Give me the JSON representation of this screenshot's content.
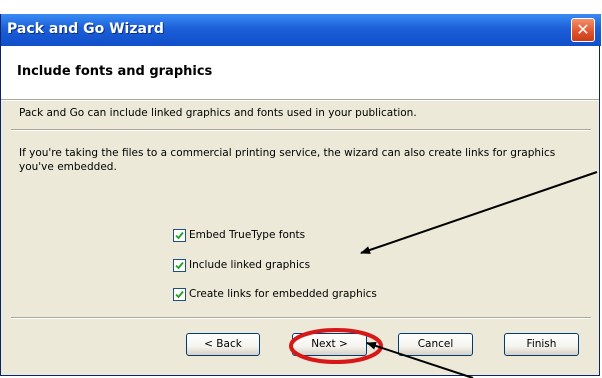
{
  "window": {
    "title": "Pack and Go Wizard",
    "close_label": "✕"
  },
  "step": {
    "title": "Include fonts and graphics",
    "description_1": "Pack and Go can include linked graphics and fonts used in your publication.",
    "description_2": "If you're taking the files to a commercial printing service, the wizard can also create links for graphics you've embedded."
  },
  "options": [
    {
      "label": "Embed TrueType fonts",
      "checked": true
    },
    {
      "label": "Include linked graphics",
      "checked": true
    },
    {
      "label": "Create links for embedded graphics",
      "checked": true
    }
  ],
  "buttons": {
    "back_label": "< Back",
    "next_label": "Next >",
    "cancel_label": "Cancel",
    "finish_label": "Finish"
  },
  "colors": {
    "titlebar": "#1c5fd9",
    "annotation_circle": "#d81818",
    "annotation_arrow": "#000000"
  }
}
